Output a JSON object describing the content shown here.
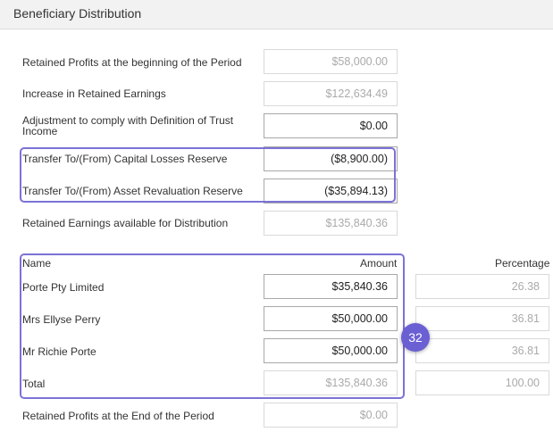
{
  "panel": {
    "title": "Beneficiary Distribution"
  },
  "rows": {
    "retained_begin": {
      "label": "Retained Profits at the beginning of the Period",
      "value": "$58,000.00"
    },
    "increase": {
      "label": "Increase in Retained Earnings",
      "value": "$122,634.49"
    },
    "adjustment": {
      "label_line1": "Adjustment to comply with Definition of Trust",
      "label_line2": "Income",
      "value": "$0.00"
    },
    "capital_losses": {
      "label": "Transfer To/(From) Capital Losses Reserve",
      "value": "($8,900.00)"
    },
    "asset_revaluation": {
      "label": "Transfer To/(From) Asset Revaluation Reserve",
      "value": "($35,894.13)"
    },
    "available": {
      "label": "Retained Earnings available for Distribution",
      "value": "$135,840.36"
    },
    "retained_end": {
      "label": "Retained Profits at the End of the Period",
      "value": "$0.00"
    }
  },
  "distribution": {
    "headers": {
      "name": "Name",
      "amount": "Amount",
      "percentage": "Percentage"
    },
    "beneficiaries": [
      {
        "name": "Porte Pty Limited",
        "amount": "$35,840.36",
        "percentage": "26.38"
      },
      {
        "name": "Mrs Ellyse Perry",
        "amount": "$50,000.00",
        "percentage": "36.81"
      },
      {
        "name": "Mr Richie Porte",
        "amount": "$50,000.00",
        "percentage": "36.81"
      }
    ],
    "total": {
      "label": "Total",
      "amount": "$135,840.36",
      "percentage": "100.00"
    }
  },
  "annotation": {
    "badge": "32"
  },
  "colors": {
    "highlight": "#7b72d6",
    "badge": "#6b5fd4"
  }
}
